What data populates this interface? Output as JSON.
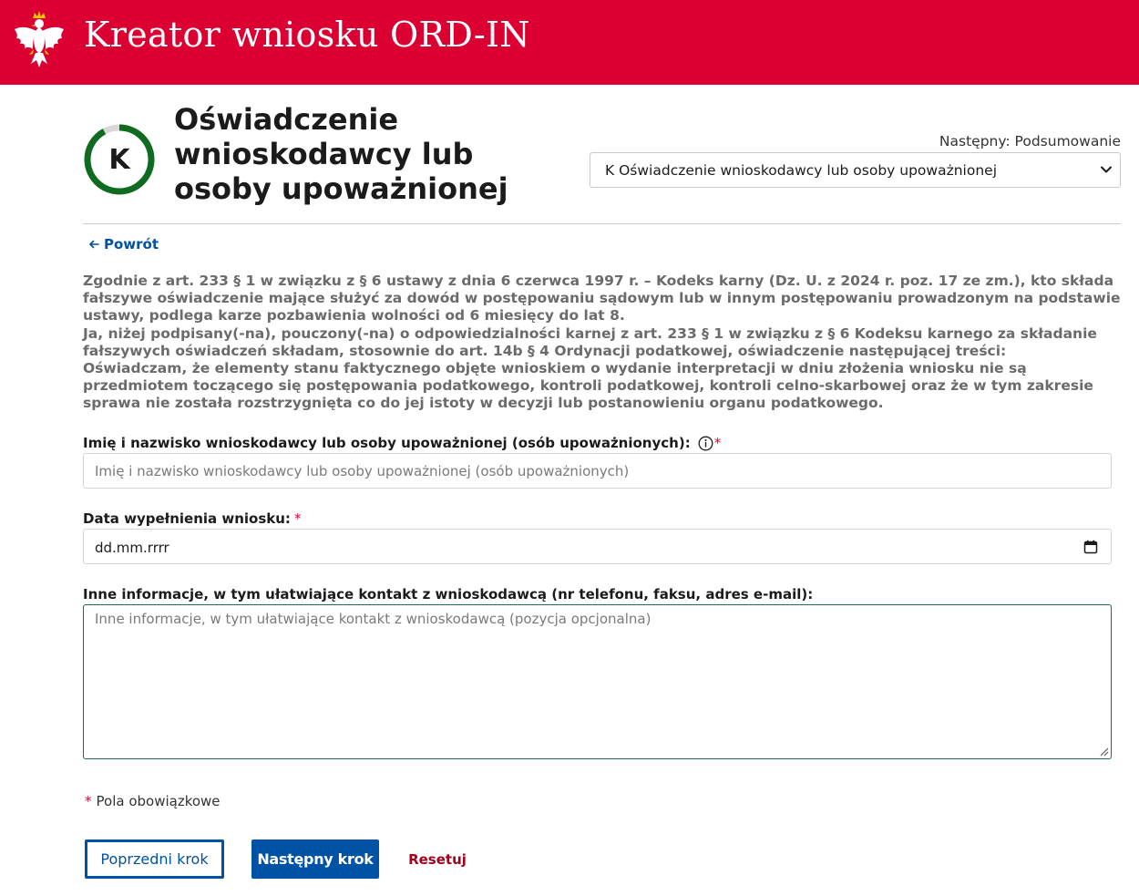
{
  "header": {
    "title": "Kreator wniosku ORD-IN",
    "bg_color": "#dc0032"
  },
  "step": {
    "letter": "K",
    "title": "Oświadczenie wnioskodawcy lub osoby upoważnionej",
    "progress": 0.92,
    "progress_color": "#0f6b1f",
    "next_label": "Następny: Podsumowanie",
    "select_value": "K Oświadczenie wnioskodawcy lub osoby upoważnionej"
  },
  "nav": {
    "back_label": "Powrót"
  },
  "legal": {
    "p1": "Zgodnie z art. 233 § 1 w związku z § 6 ustawy z dnia 6 czerwca 1997 r. – Kodeks karny (Dz. U. z 2024 r. poz. 17 ze zm.), kto składa fałszywe oświadczenie mające służyć za dowód w postępowaniu sądowym lub w innym postępowaniu prowadzonym na podstawie ustawy, podlega karze pozbawienia wolności od 6 miesięcy do lat 8.",
    "p2": "Ja, niżej podpisany(-na), pouczony(-na) o odpowiedzialności karnej z art. 233 § 1 w związku z § 6 Kodeksu karnego za składanie fałszywych oświadczeń składam, stosownie do art. 14b § 4 Ordynacji podatkowej, oświadczenie następującej treści:",
    "p3": "Oświadczam, że elementy stanu faktycznego objęte wnioskiem o wydanie interpretacji w dniu złożenia wniosku nie są przedmiotem toczącego się postępowania podatkowego, kontroli podatkowej, kontroli celno-skarbowej oraz że w tym zakresie sprawa nie została rozstrzygnięta co do jej istoty w decyzji lub postanowieniu organu podatkowego."
  },
  "form": {
    "name_label": "Imię i nazwisko wnioskodawcy lub osoby upoważnionej (osób upoważnionych):",
    "name_placeholder": "Imię i nazwisko wnioskodawcy lub osoby upoważnionej (osób upoważnionych)",
    "name_value": "",
    "date_label": "Data wypełnienia wniosku:",
    "date_value": "dd.mm.rrrr",
    "other_label": "Inne informacje, w tym ułatwiające kontakt z wnioskodawcą (nr telefonu, faksu, adres e-mail):",
    "other_placeholder": "Inne informacje, w tym ułatwiające kontakt z wnioskodawcą (pozycja opcjonalna)",
    "other_value": "",
    "required_mark": "*",
    "required_note": "Pola obowiązkowe"
  },
  "buttons": {
    "prev": "Poprzedni krok",
    "next": "Następny krok",
    "reset": "Resetuj"
  },
  "colors": {
    "primary": "#0052a5",
    "danger": "#dc0032",
    "reset": "#a3001c",
    "focus": "#1e6b4e"
  }
}
